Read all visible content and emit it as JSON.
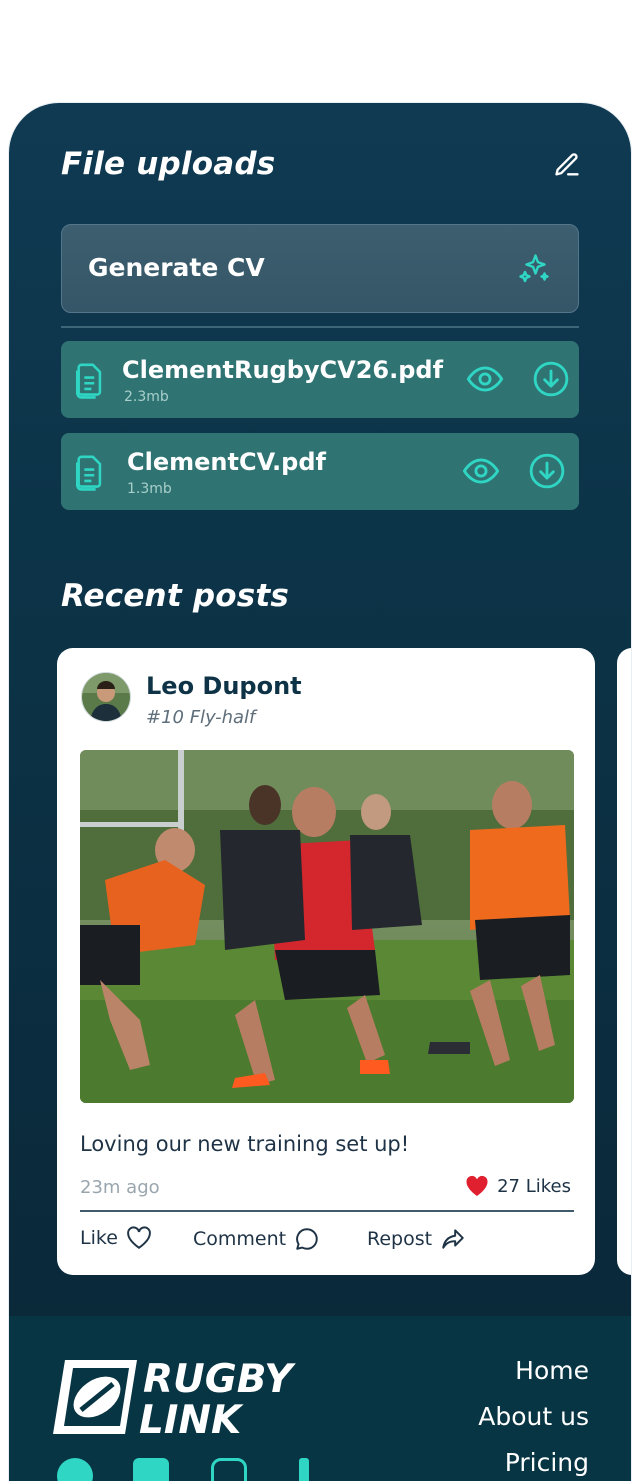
{
  "uploads": {
    "title": "File uploads",
    "generate_label": "Generate CV",
    "files": [
      {
        "name": "ClementRugbyCV26.pdf",
        "size": "2.3mb"
      },
      {
        "name": "ClementCV.pdf",
        "size": "1.3mb"
      }
    ]
  },
  "posts": {
    "title": "Recent posts",
    "items": [
      {
        "author": "Leo Dupont",
        "role": "#10 Fly-half",
        "caption": "Loving our new training set up!",
        "time": "23m ago",
        "likes": "27 Likes",
        "actions": {
          "like": "Like",
          "comment": "Comment",
          "repost": "Repost"
        }
      }
    ]
  },
  "footer": {
    "logo": "RUGBY LINK",
    "nav": [
      "Home",
      "About us",
      "Pricing"
    ]
  },
  "icons": {
    "edit": "pencil-icon",
    "generate": "sparkles-icon",
    "file": "document-icon",
    "view": "eye-icon",
    "download": "download-icon",
    "heart": "heart-icon",
    "comment": "comment-icon",
    "repost": "share-icon"
  },
  "colors": {
    "background": "#0c3347",
    "accent": "#2fd6c4",
    "file_row": "#2f7472",
    "like_red": "#e0202e",
    "footer": "#083543"
  }
}
